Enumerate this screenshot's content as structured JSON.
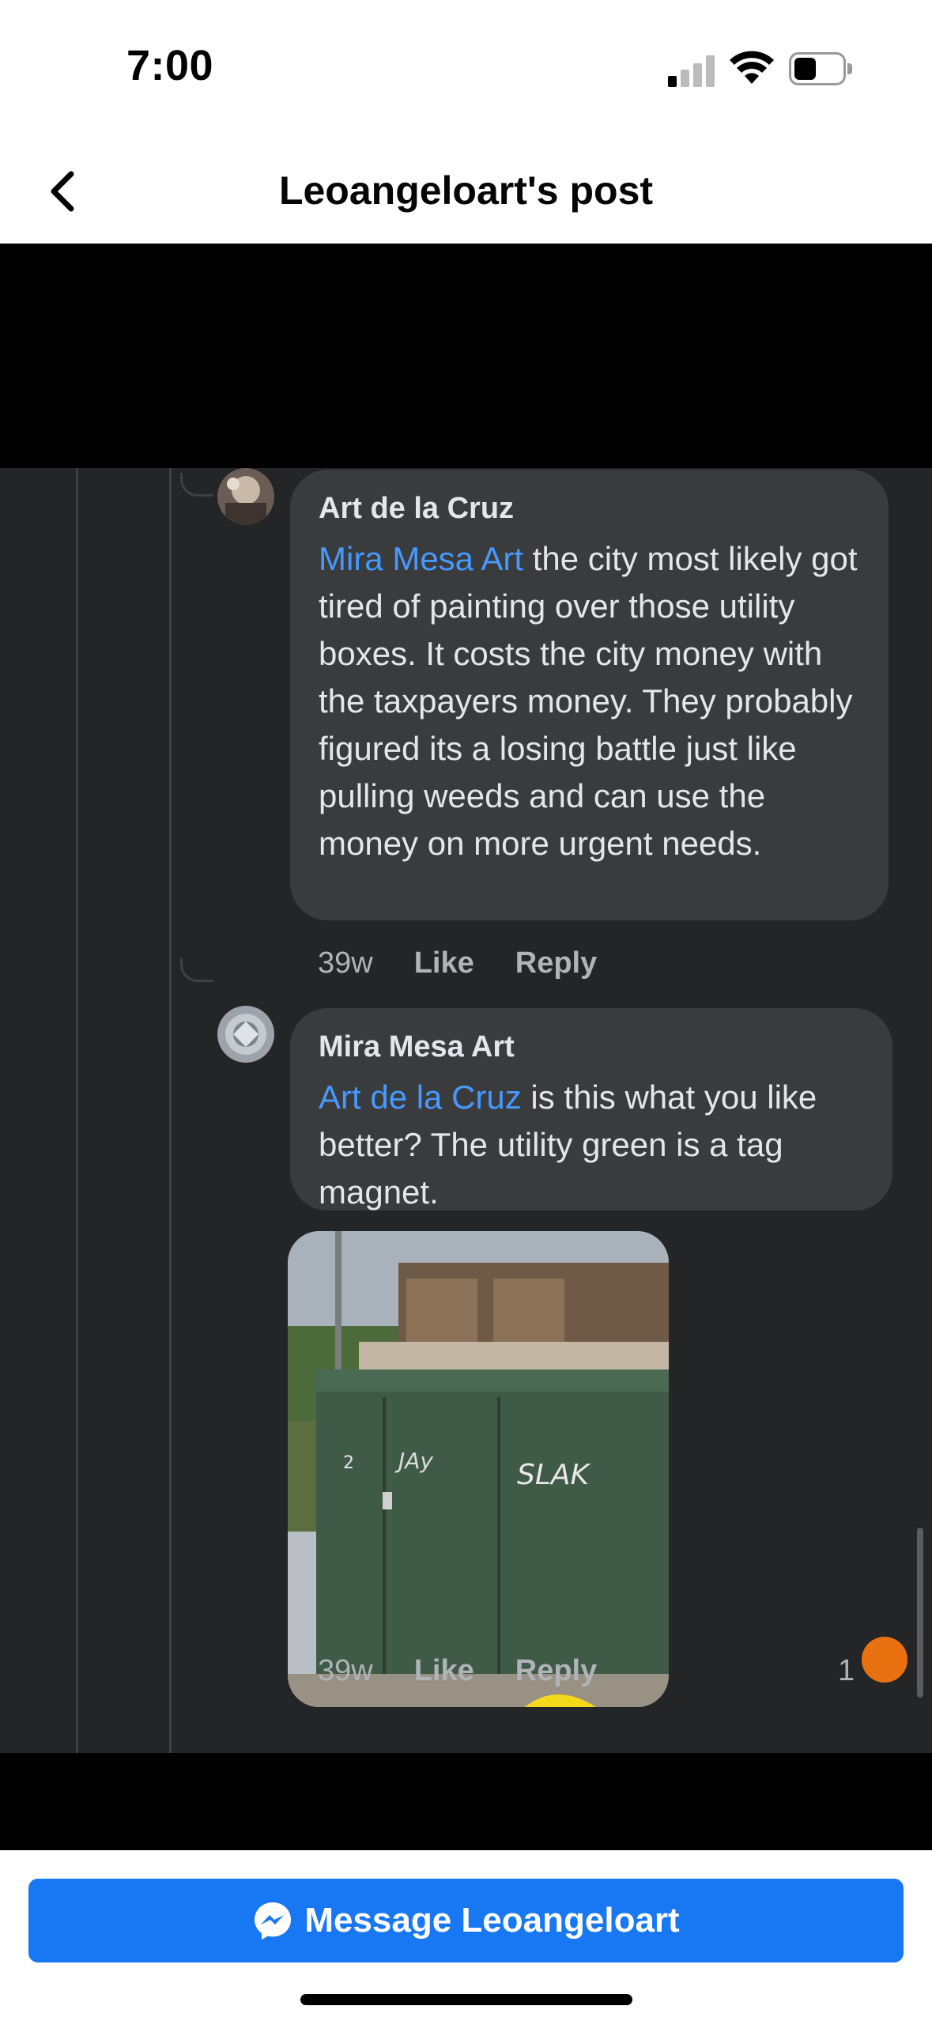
{
  "status_bar": {
    "time": "7:00"
  },
  "header": {
    "title": "Leoangeloart's post"
  },
  "comments": [
    {
      "author": "Art de la Cruz",
      "mention": "Mira Mesa Art",
      "text": " the city most likely got tired of painting over those utility boxes. It costs the city money with the taxpayers money. They probably figured its a losing battle just like pulling weeds and can use the money on more urgent needs.",
      "age": "39w",
      "like_label": "Like",
      "reply_label": "Reply"
    },
    {
      "author": "Mira Mesa Art",
      "mention": "Art de la Cruz",
      "text": " is this what you like better?  The utility green is a tag magnet.",
      "age": "39w",
      "like_label": "Like",
      "reply_label": "Reply",
      "reaction_count": "1"
    }
  ],
  "photo": {
    "tags": [
      "SLAK",
      "JAy"
    ],
    "box_label": "2"
  },
  "bottom_bar": {
    "message_label": "Message Leoangeloart"
  },
  "colors": {
    "accent": "#1877f2",
    "mention": "#4599ff",
    "comment_bg": "#3a3b3c",
    "page_bg": "#242526"
  }
}
